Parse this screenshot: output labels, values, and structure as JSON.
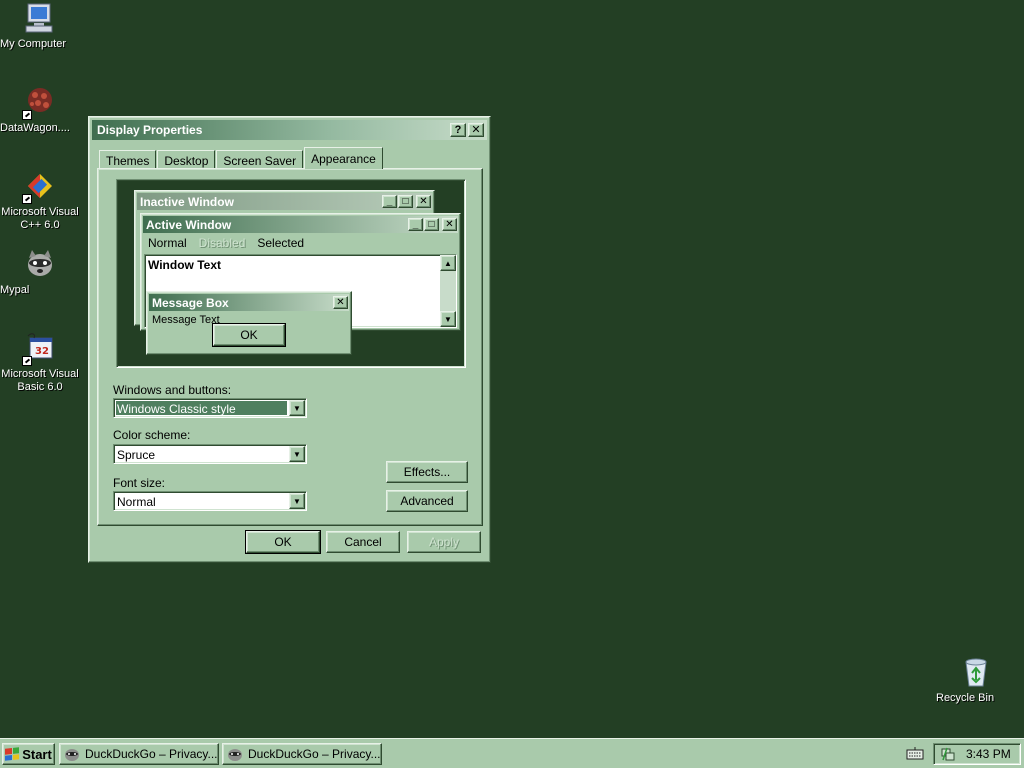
{
  "desktop": {
    "icons": [
      {
        "label": "My Computer"
      },
      {
        "label": "DataWagon...."
      },
      {
        "label": "Microsoft Visual C++ 6.0"
      },
      {
        "label": "Mypal"
      },
      {
        "label": "Microsoft Visual Basic 6.0"
      },
      {
        "label": "Recycle Bin"
      }
    ]
  },
  "dialog": {
    "title": "Display Properties",
    "help_glyph": "?",
    "close_glyph": "✕",
    "tabs": [
      {
        "label": "Themes"
      },
      {
        "label": "Desktop"
      },
      {
        "label": "Screen Saver"
      },
      {
        "label": "Appearance",
        "active": true
      }
    ],
    "preview": {
      "inactive_title": "Inactive Window",
      "active_title": "Active Window",
      "menu_normal": "Normal",
      "menu_disabled": "Disabled",
      "menu_selected": "Selected",
      "window_text": "Window Text",
      "msgbox_title": "Message Box",
      "msgbox_text": "Message Text",
      "msgbox_ok": "OK"
    },
    "windows_buttons_label": "Windows and buttons:",
    "windows_buttons_value": "Windows Classic style",
    "color_scheme_label": "Color scheme:",
    "color_scheme_value": "Spruce",
    "font_size_label": "Font size:",
    "font_size_value": "Normal",
    "effects_button": "Effects...",
    "advanced_button": "Advanced",
    "ok_button": "OK",
    "cancel_button": "Cancel",
    "apply_button": "Apply"
  },
  "taskbar": {
    "start_label": "Start",
    "tasks": [
      {
        "label": "DuckDuckGo – Privacy..."
      },
      {
        "label": "DuckDuckGo – Privacy..."
      }
    ],
    "clock": "3:43 PM"
  },
  "colors": {
    "desktop": "#233f24",
    "face": "#a9caab",
    "title_active_start": "#3f6e4f",
    "title_active_end": "#c7dcc9",
    "selection": "#4f7f5f"
  }
}
